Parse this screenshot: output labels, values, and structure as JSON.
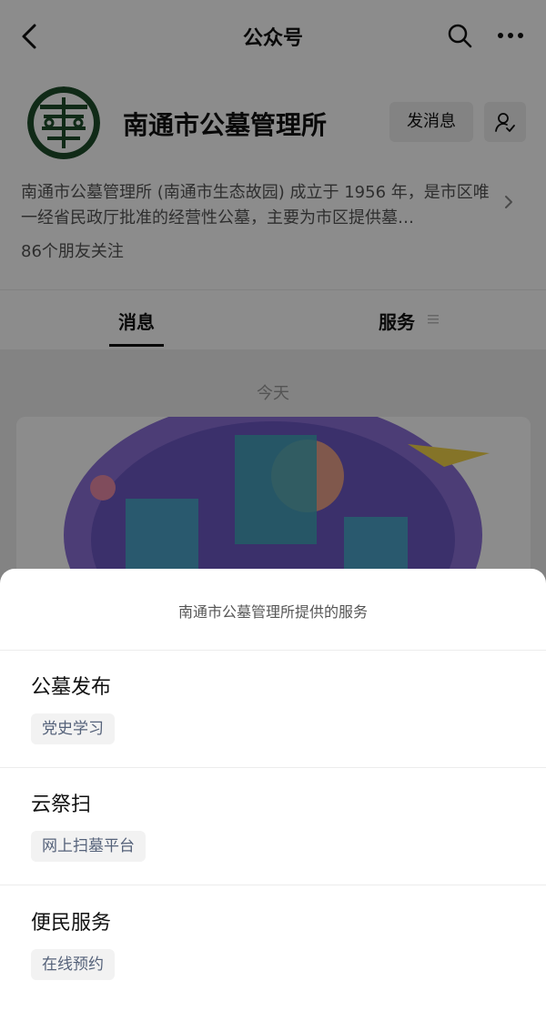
{
  "nav": {
    "title": "公众号",
    "back_icon": "chevron-left-icon",
    "search_icon": "search-icon",
    "more_icon": "more-horizontal-icon"
  },
  "profile": {
    "name": "南通市公墓管理所",
    "send_message_label": "发消息",
    "description": "南通市公墓管理所 (南通市生态故园) 成立于 1956 年，是市区唯一经省民政厅批准的经营性公墓，主要为市区提供墓…",
    "followers": "86个朋友关注",
    "logo_icon": "organization-logo",
    "follow_icon": "person-check-icon"
  },
  "tabs": [
    {
      "label": "消息",
      "selected": true
    },
    {
      "label": "服务",
      "icon": "menu-icon"
    }
  ],
  "feed": {
    "date": "今天"
  },
  "sheet": {
    "title": "南通市公墓管理所提供的服务",
    "services": [
      {
        "name": "公墓发布",
        "tag": "党史学习"
      },
      {
        "name": "云祭扫",
        "tag": "网上扫墓平台"
      },
      {
        "name": "便民服务",
        "tag": "在线预约"
      }
    ]
  },
  "colors": {
    "accent_green": "#1e4d2b",
    "tag_text": "#55627a",
    "overlay": "rgba(0,0,0,0.45)"
  }
}
